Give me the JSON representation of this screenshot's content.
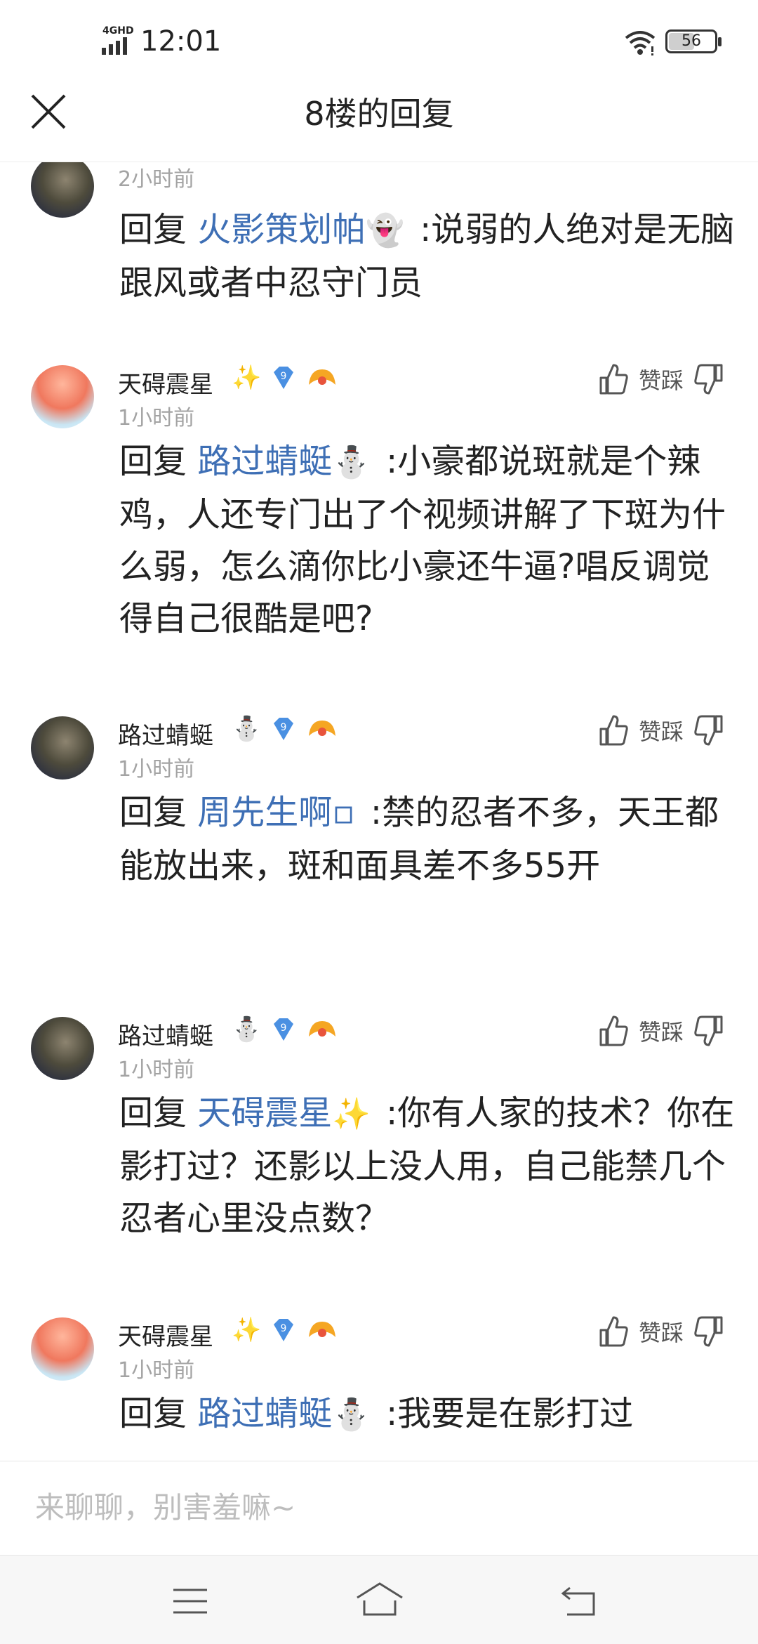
{
  "status_bar": {
    "network": "4GHD",
    "time": "12:01",
    "battery": "56",
    "battery_level": 0.56
  },
  "header": {
    "title": "8楼的回复",
    "close_icon": "close-icon"
  },
  "replies": [
    {
      "username": "",
      "time": "2小时前",
      "avatar": "dark",
      "prefix": "回复",
      "mention": "火影策划帕",
      "mention_emoji": "👻",
      "text": ":说弱的人绝对是无脑跟风或者中忍守门员"
    },
    {
      "username": "天碍震星",
      "name_emoji": "✨",
      "level": "9",
      "time": "1小时前",
      "avatar": "pink",
      "like_label": "赞",
      "dislike_label": "踩",
      "prefix": "回复",
      "mention": "路过蜻蜓",
      "mention_emoji": "⛄",
      "text": ":小豪都说斑就是个辣鸡，人还专门出了个视频讲解了下斑为什么弱，怎么滴你比小豪还牛逼?唱反调觉得自己很酷是吧?"
    },
    {
      "username": "路过蜻蜓",
      "name_emoji": "⛄",
      "level": "9",
      "time": "1小时前",
      "avatar": "dark",
      "like_label": "赞",
      "dislike_label": "踩",
      "prefix": "回复",
      "mention": "周先生啊▫",
      "mention_emoji": "",
      "text": ":禁的忍者不多，天王都能放出来，斑和面具差不多55开"
    },
    {
      "username": "路过蜻蜓",
      "name_emoji": "⛄",
      "level": "9",
      "time": "1小时前",
      "avatar": "dark",
      "like_label": "赞",
      "dislike_label": "踩",
      "prefix": "回复",
      "mention": "天碍震星",
      "mention_emoji": "✨",
      "text": ":你有人家的技术？你在影打过？还影以上没人用，自己能禁几个忍者心里没点数？"
    },
    {
      "username": "天碍震星",
      "name_emoji": "✨",
      "level": "9",
      "time": "1小时前",
      "avatar": "pink",
      "like_label": "赞",
      "dislike_label": "踩",
      "prefix": "回复",
      "mention": "路过蜻蜓",
      "mention_emoji": "⛄",
      "text": ":我要是在影打过"
    }
  ],
  "input": {
    "placeholder": "来聊聊，别害羞嘛~"
  },
  "colors": {
    "mention": "#3e6fb5",
    "time": "#a3a3a3",
    "level_badge": "#4a90e2",
    "fan_badge": "#f5a623"
  }
}
